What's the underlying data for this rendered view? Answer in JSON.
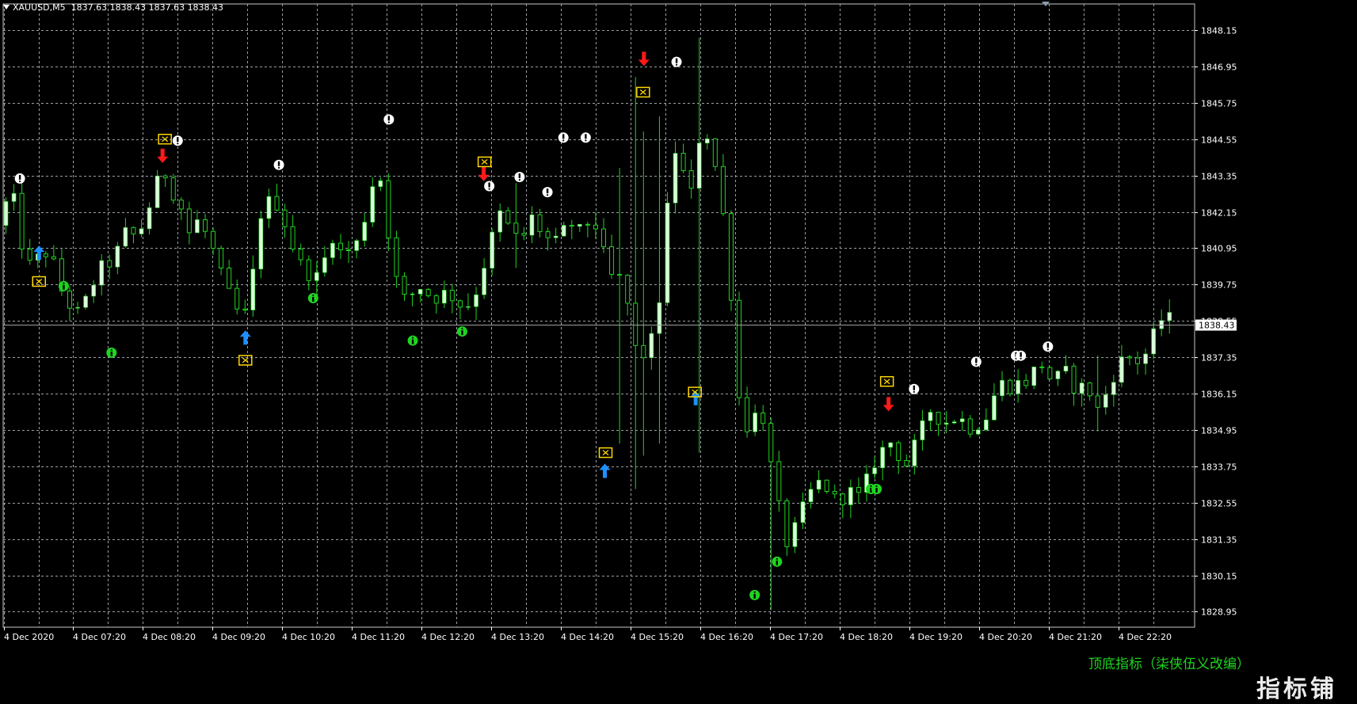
{
  "header": {
    "symbol": "XAUUSD,M5",
    "ohlc": "1837.63 1838.43 1837.63 1838.43"
  },
  "price_axis": {
    "labels": [
      "1848.15",
      "1846.95",
      "1845.75",
      "1844.55",
      "1843.35",
      "1842.15",
      "1840.95",
      "1839.75",
      "1838.55",
      "1837.35",
      "1836.15",
      "1834.95",
      "1833.75",
      "1832.55",
      "1831.35",
      "1830.15",
      "1828.95"
    ],
    "current_price": "1838.43"
  },
  "time_axis": {
    "labels": [
      "4 Dec 2020",
      "4 Dec 07:20",
      "4 Dec 08:20",
      "4 Dec 09:20",
      "4 Dec 10:20",
      "4 Dec 11:20",
      "4 Dec 12:20",
      "4 Dec 13:20",
      "4 Dec 14:20",
      "4 Dec 15:20",
      "4 Dec 16:20",
      "4 Dec 17:20",
      "4 Dec 18:20",
      "4 Dec 19:20",
      "4 Dec 20:20",
      "4 Dec 21:20",
      "4 Dec 22:20"
    ]
  },
  "indicator_label": "顶底指标（柒侠伍义改编）",
  "watermark": "指标铺",
  "colors": {
    "background": "#000000",
    "grid": "#9aa0a6",
    "candle_wick": "#1fd41f",
    "candle_body_bull": "#d9ffd9",
    "axis_text": "#ffffff",
    "current_price_line": "#a0a0a0",
    "buy_arrow": "#1e90ff",
    "sell_arrow": "#ff1a1a",
    "signal_box": "#ffd700",
    "bottom_marker": "#1fd41f",
    "top_marker": "#ffffff"
  },
  "chart_data": {
    "type": "candlestick",
    "symbol": "XAUUSD",
    "timeframe": "M5",
    "ylim": [
      1828.4,
      1848.8
    ],
    "grid": true,
    "start_time": "4 Dec 2020 06:20",
    "end_time": "4 Dec 2020 23:15",
    "close_path": [
      [
        0,
        1841.7
      ],
      [
        1.7,
        1842.9
      ],
      [
        3.0,
        1841.1
      ],
      [
        4.1,
        1840.3
      ],
      [
        5.0,
        1840.6
      ],
      [
        6.4,
        1840.9
      ],
      [
        8.3,
        1839.3
      ],
      [
        10.3,
        1838.7
      ],
      [
        11.3,
        1839.4
      ],
      [
        12.6,
        1840.2
      ],
      [
        14.6,
        1840.6
      ],
      [
        16.1,
        1841.5
      ],
      [
        17.5,
        1841.3
      ],
      [
        18.8,
        1842.2
      ],
      [
        19.6,
        1842.8
      ],
      [
        20.7,
        1843.6
      ],
      [
        21.8,
        1842.9
      ],
      [
        22.9,
        1842.4
      ],
      [
        23.8,
        1841.4
      ],
      [
        25.2,
        1841.9
      ],
      [
        26.7,
        1841.1
      ],
      [
        28.3,
        1839.8
      ],
      [
        29.7,
        1839.0
      ],
      [
        30.8,
        1838.5
      ],
      [
        31.8,
        1839.7
      ],
      [
        33.0,
        1842.1
      ],
      [
        34.4,
        1842.6
      ],
      [
        35.5,
        1842.3
      ],
      [
        36.4,
        1841.4
      ],
      [
        38.0,
        1840.4
      ],
      [
        39.2,
        1840.1
      ],
      [
        40.4,
        1839.9
      ],
      [
        41.8,
        1841.5
      ],
      [
        43.2,
        1840.7
      ],
      [
        45.0,
        1841.1
      ],
      [
        46.5,
        1842.4
      ],
      [
        47.6,
        1843.9
      ],
      [
        48.7,
        1842.1
      ],
      [
        49.7,
        1840.1
      ],
      [
        51.1,
        1839.2
      ],
      [
        52.9,
        1839.7
      ],
      [
        54.6,
        1839.3
      ],
      [
        56.5,
        1839.5
      ],
      [
        58.4,
        1839.0
      ],
      [
        59.6,
        1839.2
      ],
      [
        61.2,
        1840.6
      ],
      [
        62.9,
        1842.1
      ],
      [
        64.2,
        1841.6
      ],
      [
        65.5,
        1841.1
      ],
      [
        67.1,
        1842.0
      ],
      [
        68.6,
        1841.3
      ],
      [
        70.1,
        1841.1
      ],
      [
        71.7,
        1841.8
      ],
      [
        73.3,
        1841.4
      ],
      [
        74.6,
        1842.1
      ],
      [
        75.9,
        1840.8
      ],
      [
        77.4,
        1839.7
      ],
      [
        78.0,
        1839.9
      ],
      [
        79.0,
        1839.1
      ],
      [
        80.2,
        1837.3
      ],
      [
        81.8,
        1837.6
      ],
      [
        83.2,
        1839.6
      ],
      [
        84.3,
        1843.2
      ],
      [
        85.3,
        1844.6
      ],
      [
        86.7,
        1842.2
      ],
      [
        88.4,
        1845.3
      ],
      [
        89.5,
        1844.2
      ],
      [
        90.5,
        1843.1
      ],
      [
        91.8,
        1840.3
      ],
      [
        92.8,
        1836.2
      ],
      [
        94.0,
        1835.1
      ],
      [
        95.8,
        1835.7
      ],
      [
        97.4,
        1833.1
      ],
      [
        98.9,
        1831.2
      ],
      [
        100.1,
        1831.7
      ],
      [
        101.7,
        1832.8
      ],
      [
        103.4,
        1833.3
      ],
      [
        105.1,
        1832.6
      ],
      [
        106.9,
        1832.9
      ],
      [
        108.2,
        1832.7
      ],
      [
        110.3,
        1834.1
      ],
      [
        112.2,
        1834.6
      ],
      [
        113.8,
        1833.7
      ],
      [
        115.2,
        1834.5
      ],
      [
        117.0,
        1835.6
      ],
      [
        118.8,
        1835.2
      ],
      [
        120.4,
        1835.4
      ],
      [
        122.2,
        1835.0
      ],
      [
        124.0,
        1835.4
      ],
      [
        125.6,
        1836.5
      ],
      [
        127.2,
        1836.4
      ],
      [
        129.3,
        1836.6
      ],
      [
        130.8,
        1837.2
      ],
      [
        132.4,
        1836.5
      ],
      [
        133.8,
        1836.9
      ],
      [
        135.0,
        1836.4
      ],
      [
        136.8,
        1836.3
      ],
      [
        138.2,
        1835.5
      ],
      [
        139.6,
        1836.6
      ],
      [
        141.4,
        1837.4
      ],
      [
        143.4,
        1837.2
      ],
      [
        144.3,
        1837.6
      ],
      [
        145.9,
        1838.6
      ]
    ],
    "signals": [
      {
        "type": "top",
        "bar": 1.8,
        "price": 1843.25
      },
      {
        "type": "sell",
        "bar": 19.7,
        "price": 1844.0
      },
      {
        "type": "top",
        "bar": 21.6,
        "price": 1844.5
      },
      {
        "type": "top",
        "bar": 34.3,
        "price": 1843.7
      },
      {
        "type": "top",
        "bar": 48.1,
        "price": 1845.2
      },
      {
        "type": "sell",
        "bar": 60.0,
        "price": 1843.4
      },
      {
        "type": "top",
        "bar": 60.7,
        "price": 1843.0
      },
      {
        "type": "top",
        "bar": 64.5,
        "price": 1843.3
      },
      {
        "type": "top",
        "bar": 68.0,
        "price": 1842.8
      },
      {
        "type": "top",
        "bar": 70.0,
        "price": 1844.6
      },
      {
        "type": "top",
        "bar": 72.8,
        "price": 1844.6
      },
      {
        "type": "sell",
        "bar": 80.1,
        "price": 1847.2
      },
      {
        "type": "top",
        "bar": 84.2,
        "price": 1847.1
      },
      {
        "type": "top",
        "bar": 114.0,
        "price": 1836.3
      },
      {
        "type": "sell",
        "bar": 110.8,
        "price": 1835.8
      },
      {
        "type": "top",
        "bar": 121.8,
        "price": 1837.2
      },
      {
        "type": "top",
        "bar": 126.8,
        "price": 1837.4
      },
      {
        "type": "top",
        "bar": 127.4,
        "price": 1837.4
      },
      {
        "type": "top",
        "bar": 130.8,
        "price": 1837.7
      },
      {
        "type": "buy",
        "bar": 4.2,
        "price": 1840.8
      },
      {
        "type": "buy",
        "bar": 30.1,
        "price": 1838.0
      },
      {
        "type": "buy",
        "bar": 75.2,
        "price": 1833.6
      },
      {
        "type": "buy",
        "bar": 86.6,
        "price": 1836.0
      },
      {
        "type": "bottom",
        "bar": 7.3,
        "price": 1839.7
      },
      {
        "type": "bottom",
        "bar": 13.3,
        "price": 1837.5
      },
      {
        "type": "bottom",
        "bar": 38.6,
        "price": 1839.3
      },
      {
        "type": "bottom",
        "bar": 51.1,
        "price": 1837.9
      },
      {
        "type": "bottom",
        "bar": 57.3,
        "price": 1838.2
      },
      {
        "type": "bottom",
        "bar": 94.0,
        "price": 1829.5
      },
      {
        "type": "bottom",
        "bar": 96.8,
        "price": 1830.6
      },
      {
        "type": "bottom",
        "bar": 108.6,
        "price": 1833.0
      },
      {
        "type": "bottom",
        "bar": 109.3,
        "price": 1833.0
      }
    ],
    "boxes": [
      {
        "bar": 4.2,
        "price": 1839.85
      },
      {
        "bar": 20.0,
        "price": 1844.55
      },
      {
        "bar": 30.1,
        "price": 1837.25
      },
      {
        "bar": 60.1,
        "price": 1843.8
      },
      {
        "bar": 75.3,
        "price": 1834.2
      },
      {
        "bar": 80.0,
        "price": 1846.1
      },
      {
        "bar": 86.5,
        "price": 1836.2
      },
      {
        "bar": 110.6,
        "price": 1836.55
      }
    ]
  }
}
